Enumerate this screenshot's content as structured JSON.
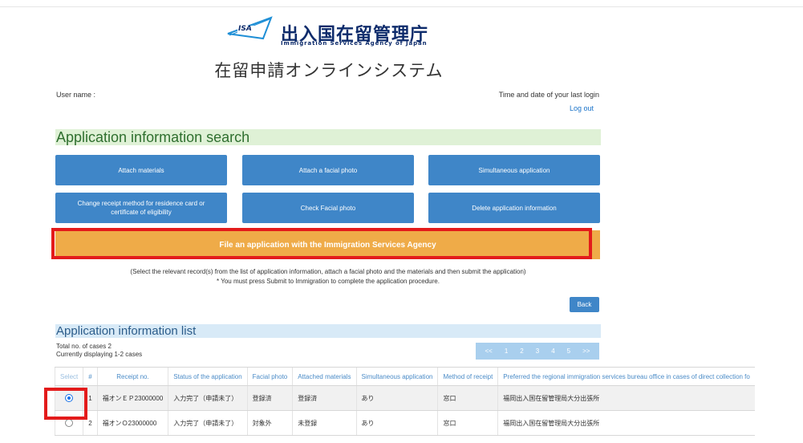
{
  "header": {
    "logo_text": "ISA",
    "agency_name_jp": "出入国在留管理庁",
    "agency_name_en": "Immigration Services Agency of Japan",
    "system_title": "在留申請オンラインシステム",
    "user_label": "User name :",
    "last_login_label": "Time and date of your last login",
    "logout_label": "Log out"
  },
  "search": {
    "title": "Application information search",
    "buttons": [
      "Attach materials",
      "Attach a facial photo",
      "Simultaneous application",
      "Change receipt method for residence card or certificate of eligibility",
      "Check Facial photo",
      "Delete application information"
    ],
    "file_button": "File an application with the Immigration Services Agency",
    "instruction_1": "(Select the relevant record(s) from the list of application information, attach a facial photo and the materials and then submit the application)",
    "instruction_2": "* You must press Submit to Immigration to complete the application procedure.",
    "back_label": "Back"
  },
  "list": {
    "title": "Application information list",
    "total": "Total no. of cases 2",
    "displaying": "Currently displaying 1-2 cases",
    "pager": [
      "<<",
      "1",
      "2",
      "3",
      "4",
      "5",
      ">>"
    ],
    "columns": [
      "Select",
      "#",
      "Receipt no.",
      "Status of the application",
      "Facial photo",
      "Attached materials",
      "Simultaneous application",
      "Method of receipt",
      "Preferred the regional immigration services bureau office in cases of direct collection fo"
    ],
    "rows": [
      {
        "selected": true,
        "no": "1",
        "receipt": "福オンＥＰ23000000",
        "status": "入力完了（申請未了）",
        "photo": "登録済",
        "materials": "登録済",
        "simultaneous": "あり",
        "method": "窓口",
        "office": "福岡出入国在留管理局大分出張所"
      },
      {
        "selected": false,
        "no": "2",
        "receipt": "福オンＯ23000000",
        "status": "入力完了（申請未了）",
        "photo": "対象外",
        "materials": "未登録",
        "simultaneous": "あり",
        "method": "窓口",
        "office": "福岡出入国在留管理局大分出張所"
      }
    ]
  },
  "colors": {
    "primary_button": "#3f86c8",
    "file_button": "#efab48",
    "highlight": "#e31b1b",
    "search_header_bg": "#dff1d6",
    "list_header_bg": "#d8eaf7"
  }
}
